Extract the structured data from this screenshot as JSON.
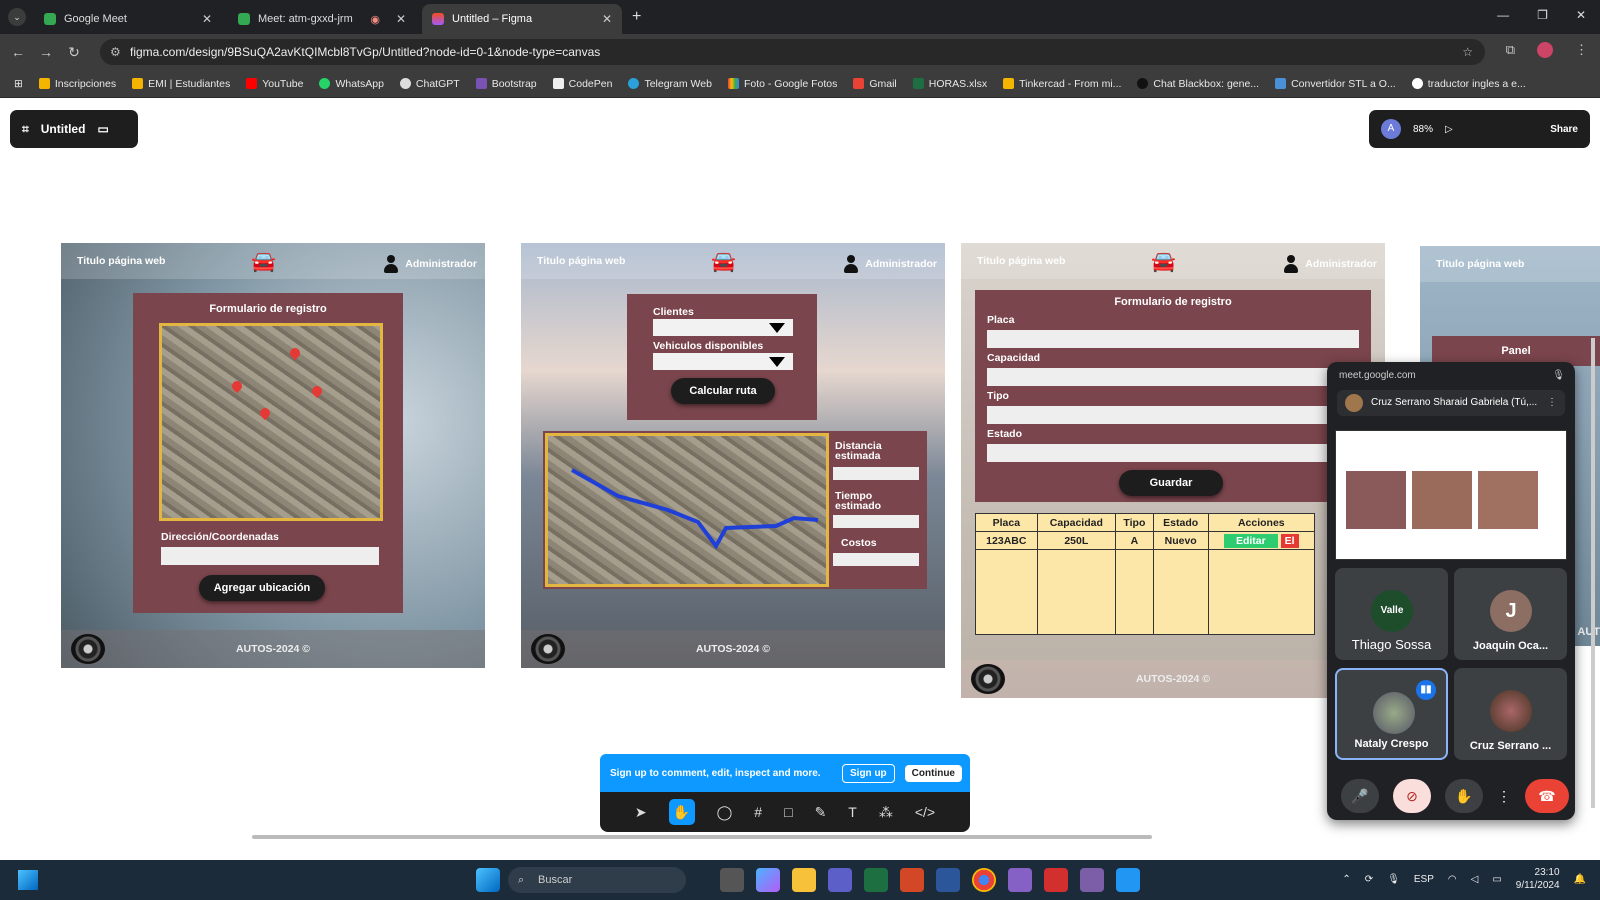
{
  "browser": {
    "tabs": [
      {
        "label": "Google Meet",
        "active": false
      },
      {
        "label": "Meet: atm-gxxd-jrm",
        "active": false
      },
      {
        "label": "Untitled – Figma",
        "active": true
      }
    ],
    "url": "figma.com/design/9BSuQA2avKtQIMcbl8TvGp/Untitled?node-id=0-1&node-type=canvas",
    "bookmarks": [
      "Inscripciones",
      "EMI | Estudiantes",
      "YouTube",
      "WhatsApp",
      "ChatGPT",
      "Bootstrap",
      "CodePen",
      "Telegram Web",
      "Foto - Google Fotos",
      "Gmail",
      "HORAS.xlsx",
      "Tinkercad - From mi...",
      "Chat Blackbox: gene...",
      "Convertidor STL a O...",
      "traductor ingles a e..."
    ]
  },
  "figma": {
    "file_name": "Untitled",
    "avatar_letter": "A",
    "zoom": "88%",
    "share": "Share"
  },
  "frame1": {
    "title": "Titulo página web",
    "user": "Administrador",
    "form_title": "Formulario de registro",
    "address_label": "Dirección/Coordenadas",
    "button": "Agregar ubicación",
    "footer": "AUTOS-2024 ©"
  },
  "frame2": {
    "title": "Titulo página web",
    "user": "Administrador",
    "clients_label": "Clientes",
    "vehicles_label": "Vehiculos disponibles",
    "button": "Calcular ruta",
    "distance_label": "Distancia estimada",
    "time_label": "Tiempo estimado",
    "cost_label": "Costos",
    "footer": "AUTOS-2024 ©"
  },
  "frame3": {
    "title": "Titulo página web",
    "user": "Administrador",
    "form_title": "Formulario de registro",
    "fields": [
      "Placa",
      "Capacidad",
      "Tipo",
      "Estado"
    ],
    "button": "Guardar",
    "table_headers": [
      "Placa",
      "Capacidad",
      "Tipo",
      "Estado",
      "Acciones"
    ],
    "table_row": [
      "123ABC",
      "250L",
      "A",
      "Nuevo"
    ],
    "edit": "Editar",
    "delete": "El",
    "footer": "AUTOS-2024 ©"
  },
  "frame4": {
    "title": "Titulo página web",
    "panel": "Panel",
    "footer": "AUT"
  },
  "meet": {
    "source": "meet.google.com",
    "presenter": "Cruz Serrano Sharaid Gabriela (Tú,...",
    "participants": [
      {
        "name": "Thiago Sossa",
        "badge": "Valle"
      },
      {
        "name": "Joaquin Oca...",
        "initial": "J"
      },
      {
        "name": "Nataly Crespo"
      },
      {
        "name": "Cruz Serrano ..."
      }
    ]
  },
  "toast": {
    "message": "Sign up to comment, edit, inspect and more.",
    "signup": "Sign up",
    "continue": "Continue"
  },
  "taskbar": {
    "search": "Buscar",
    "lang": "ESP",
    "time": "23:10",
    "date": "9/11/2024"
  }
}
